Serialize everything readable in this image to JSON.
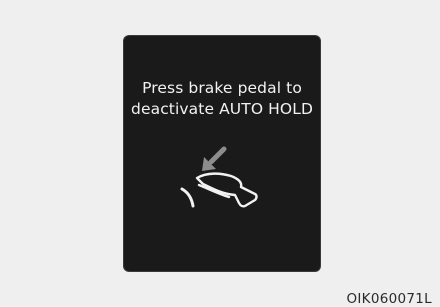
{
  "display": {
    "message_line1": "Press brake pedal to",
    "message_line2": "deactivate AUTO HOLD",
    "icon": "foot-on-brake-pedal-icon"
  },
  "image_code": "OIK060071L",
  "colors": {
    "page_background": "#efefef",
    "display_background": "#1a1a1a",
    "display_text": "#f2f2f2",
    "arrow_gray": "#8c8c8c"
  }
}
